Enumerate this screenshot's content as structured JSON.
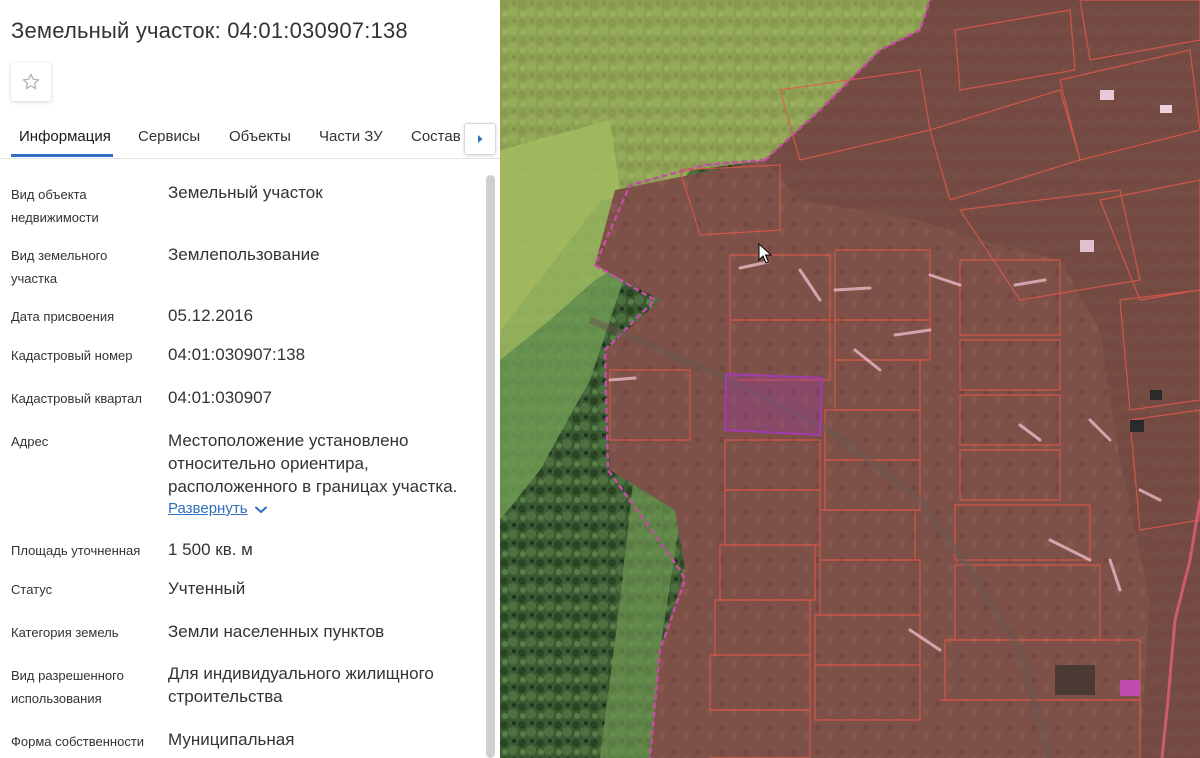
{
  "header": {
    "title": "Земельный участок: 04:01:030907:138"
  },
  "favorite": {
    "icon": "star-outline-icon"
  },
  "tabs": [
    {
      "label": "Информация"
    },
    {
      "label": "Сервисы"
    },
    {
      "label": "Объекты"
    },
    {
      "label": "Части ЗУ"
    },
    {
      "label": "Состав"
    }
  ],
  "tabs_scroll": {
    "icon": "caret-right-icon"
  },
  "info": {
    "object_type": {
      "label": "Вид объекта недвижимости",
      "value": "Земельный участок"
    },
    "land_type": {
      "label": "Вид земельного участка",
      "value": "Землепользование"
    },
    "assignment_date": {
      "label": "Дата присвоения",
      "value": "05.12.2016"
    },
    "cadastral_number": {
      "label": "Кадастровый номер",
      "value": "04:01:030907:138"
    },
    "cadastral_quarter": {
      "label": "Кадастровый квартал",
      "value": "04:01:030907"
    },
    "address": {
      "label": "Адрес",
      "value": "Местоположение установлено относительно ориентира, расположенного в границах участка.",
      "expand_label": "Развернуть"
    },
    "area": {
      "label": "Площадь уточненная",
      "value": "1 500 кв. м"
    },
    "status": {
      "label": "Статус",
      "value": "Учтенный"
    },
    "land_category": {
      "label": "Категория земель",
      "value": "Земли населенных пунктов"
    },
    "permitted_use": {
      "label": "Вид разрешенного использования",
      "value": "Для индивидуального жилищного строительства"
    },
    "ownership": {
      "label": "Форма собственности",
      "value": "Муниципальная"
    }
  },
  "colors": {
    "accent": "#2f6fbe",
    "parcel_fill": "#8a4a48",
    "parcel_border": "#e0584a",
    "selected_parcel": "#a23bb0",
    "forest": "#2f4a2a",
    "meadow": "#a9b86a"
  }
}
